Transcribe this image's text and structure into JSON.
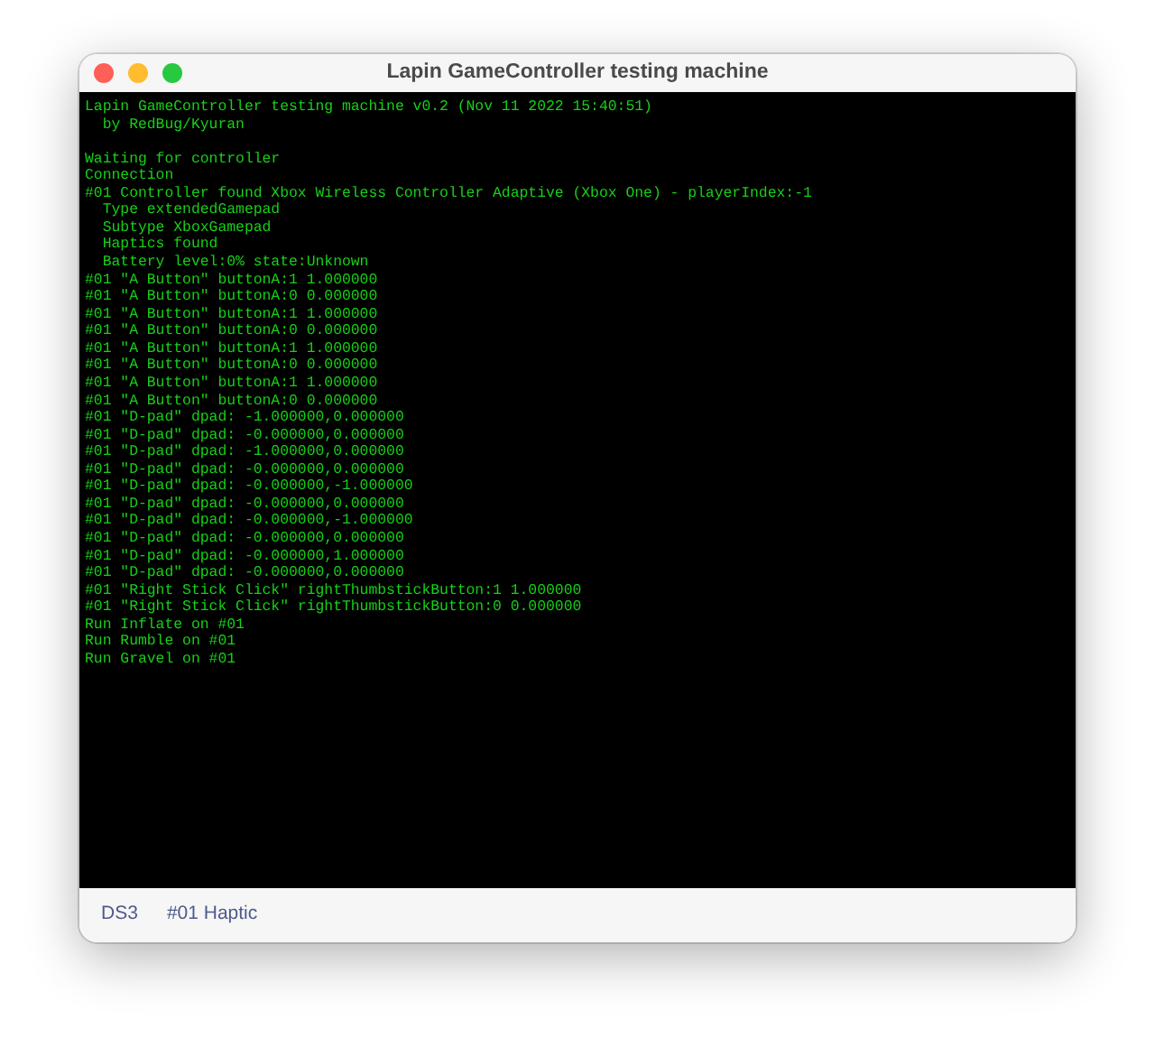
{
  "window": {
    "title": "Lapin GameController testing machine"
  },
  "console": {
    "blocks": [
      [
        "Lapin GameController testing machine v0.2 (Nov 11 2022 15:40:51)",
        "  by RedBug/Kyuran"
      ],
      [
        "Waiting for controller",
        "Connection",
        "#01 Controller found Xbox Wireless Controller Adaptive (Xbox One) - playerIndex:-1",
        "  Type extendedGamepad",
        "  Subtype XboxGamepad",
        "  Haptics found",
        "  Battery level:0% state:Unknown",
        "#01 \"A Button\" buttonA:1 1.000000",
        "#01 \"A Button\" buttonA:0 0.000000",
        "#01 \"A Button\" buttonA:1 1.000000",
        "#01 \"A Button\" buttonA:0 0.000000",
        "#01 \"A Button\" buttonA:1 1.000000",
        "#01 \"A Button\" buttonA:0 0.000000",
        "#01 \"A Button\" buttonA:1 1.000000",
        "#01 \"A Button\" buttonA:0 0.000000",
        "#01 \"D-pad\" dpad: -1.000000,0.000000",
        "#01 \"D-pad\" dpad: -0.000000,0.000000",
        "#01 \"D-pad\" dpad: -1.000000,0.000000",
        "#01 \"D-pad\" dpad: -0.000000,0.000000",
        "#01 \"D-pad\" dpad: -0.000000,-1.000000",
        "#01 \"D-pad\" dpad: -0.000000,0.000000",
        "#01 \"D-pad\" dpad: -0.000000,-1.000000",
        "#01 \"D-pad\" dpad: -0.000000,0.000000",
        "#01 \"D-pad\" dpad: -0.000000,1.000000",
        "#01 \"D-pad\" dpad: -0.000000,0.000000",
        "#01 \"Right Stick Click\" rightThumbstickButton:1 1.000000",
        "#01 \"Right Stick Click\" rightThumbstickButton:0 0.000000",
        "Run Inflate on #01",
        "Run Rumble on #01",
        "Run Gravel on #01"
      ]
    ]
  },
  "toolbar": {
    "buttons": [
      "DS3",
      "#01 Haptic"
    ]
  }
}
